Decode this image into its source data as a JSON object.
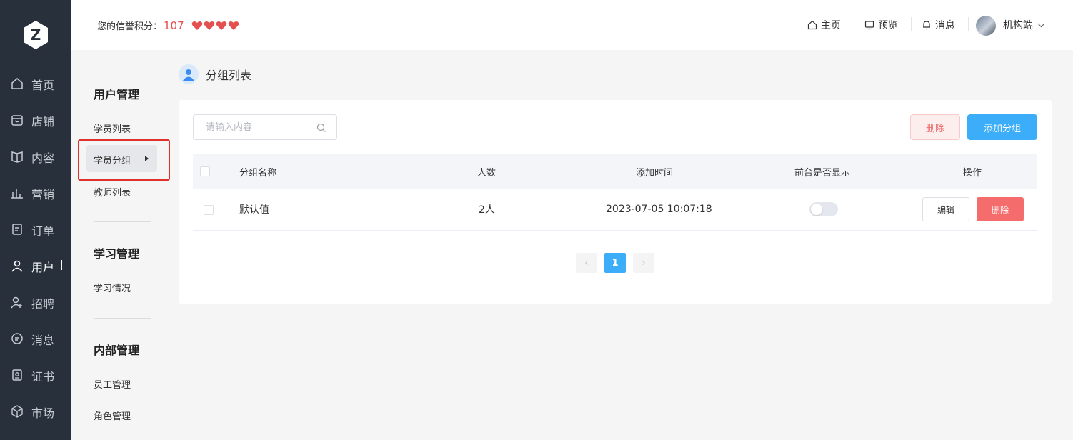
{
  "header": {
    "credit_label": "您的信誉积分：",
    "credit_value": "107",
    "hearts_count": 4,
    "links": [
      {
        "label": "主页",
        "icon": "home-icon"
      },
      {
        "label": "预览",
        "icon": "monitor-icon"
      },
      {
        "label": "消息",
        "icon": "bell-icon"
      }
    ],
    "user_name": "机构端"
  },
  "nav": {
    "logo_letter": "Z",
    "items": [
      {
        "label": "首页",
        "icon": "home-icon"
      },
      {
        "label": "店铺",
        "icon": "store-icon"
      },
      {
        "label": "内容",
        "icon": "book-icon"
      },
      {
        "label": "营销",
        "icon": "chart-icon"
      },
      {
        "label": "订单",
        "icon": "order-icon"
      },
      {
        "label": "用户",
        "icon": "user-icon",
        "active": true
      },
      {
        "label": "招聘",
        "icon": "recruit-icon"
      },
      {
        "label": "消息",
        "icon": "message-icon"
      },
      {
        "label": "证书",
        "icon": "certificate-icon"
      },
      {
        "label": "市场",
        "icon": "market-icon"
      }
    ]
  },
  "subnav": {
    "groups": [
      {
        "title": "用户管理",
        "items": [
          "学员列表",
          "学员分组",
          "教师列表"
        ]
      },
      {
        "title": "学习管理",
        "items": [
          "学习情况"
        ]
      },
      {
        "title": "内部管理",
        "items": [
          "员工管理",
          "角色管理"
        ]
      }
    ],
    "active_item": "学员分组"
  },
  "page": {
    "title": "分组列表",
    "search_placeholder": "请输入内容",
    "delete_label": "删除",
    "add_label": "添加分组"
  },
  "table": {
    "columns": [
      "分组名称",
      "人数",
      "添加时间",
      "前台是否显示",
      "操作"
    ],
    "rows": [
      {
        "name": "默认值",
        "count": "2人",
        "time": "2023-07-05 10:07:18",
        "visible": false,
        "edit_label": "编辑",
        "delete_label": "删除"
      }
    ]
  },
  "pagination": {
    "current": "1",
    "prev": "‹",
    "next": "›"
  },
  "colors": {
    "accent": "#3cadf8",
    "danger": "#f56c6c",
    "sidebar": "#28303b",
    "credit": "#e4504f"
  }
}
